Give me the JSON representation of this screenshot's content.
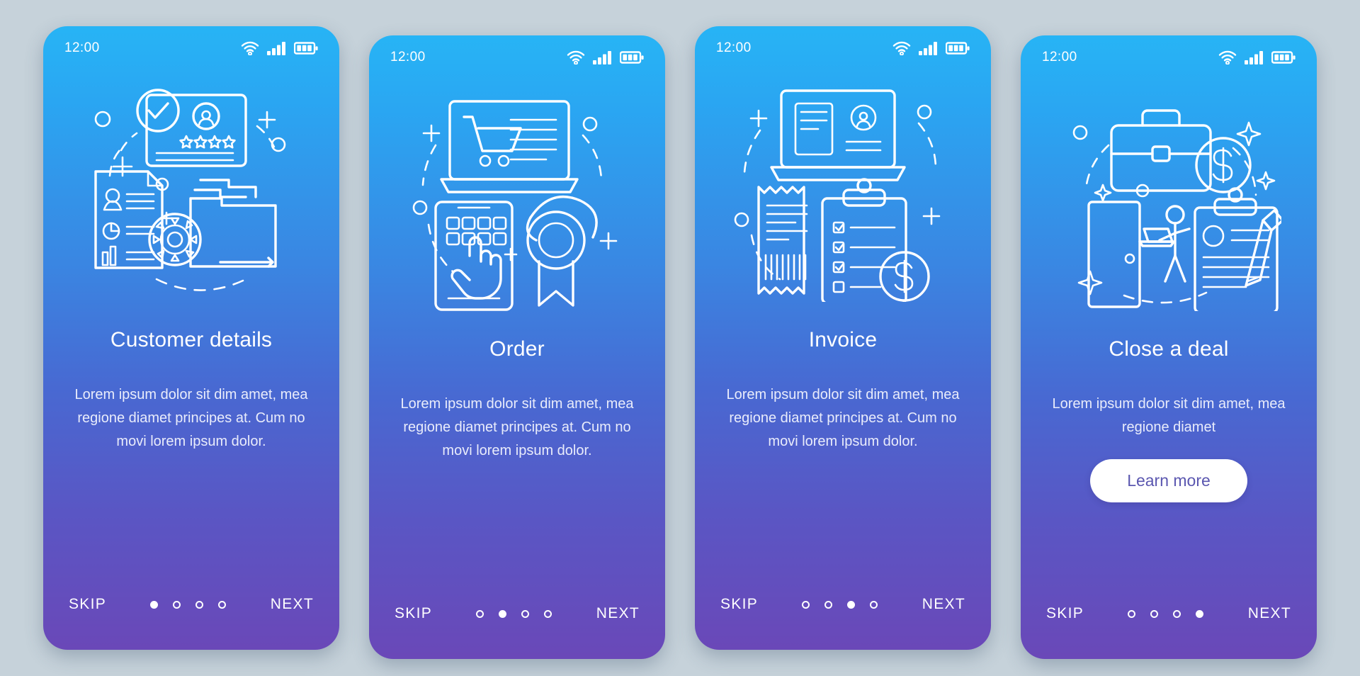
{
  "background_color": "#c6d2da",
  "gradient": {
    "top": "#27b4f5",
    "middle": "#4869d2",
    "bottom": "#6a48b8"
  },
  "accent": {
    "button_bg": "#ffffff",
    "button_text": "#5b57b0",
    "stroke": "#ffffff"
  },
  "status_bar": {
    "time": "12:00",
    "icons": [
      "wifi-icon",
      "cellular-signal-icon",
      "battery-icon"
    ]
  },
  "screens": [
    {
      "id": "customer-details",
      "illustration": "customer-profile-card-folder-gear-illustration",
      "title": "Customer details",
      "description": "Lorem ipsum dolor sit dim amet, mea regione diamet principes at. Cum no movi lorem ipsum dolor.",
      "skip_label": "SKIP",
      "next_label": "NEXT",
      "dots_total": 4,
      "dot_active": 1,
      "has_button": false,
      "button_label": ""
    },
    {
      "id": "order",
      "illustration": "laptop-shopping-cart-phone-tap-badge-illustration",
      "title": "Order",
      "description": "Lorem ipsum dolor sit dim amet, mea regione diamet principes at. Cum no movi lorem ipsum dolor.",
      "skip_label": "SKIP",
      "next_label": "NEXT",
      "dots_total": 4,
      "dot_active": 2,
      "has_button": false,
      "button_label": ""
    },
    {
      "id": "invoice",
      "illustration": "laptop-receipt-clipboard-dollar-illustration",
      "title": "Invoice",
      "description": "Lorem ipsum dolor sit dim amet, mea regione diamet principes at. Cum no movi lorem ipsum dolor.",
      "skip_label": "SKIP",
      "next_label": "NEXT",
      "dots_total": 4,
      "dot_active": 3,
      "has_button": false,
      "button_label": ""
    },
    {
      "id": "close-a-deal",
      "illustration": "briefcase-dollar-handshake-contract-illustration",
      "title": "Close a deal",
      "description": "Lorem ipsum dolor sit dim amet, mea regione diamet",
      "skip_label": "SKIP",
      "next_label": "NEXT",
      "dots_total": 4,
      "dot_active": 4,
      "has_button": true,
      "button_label": "Learn more"
    }
  ]
}
